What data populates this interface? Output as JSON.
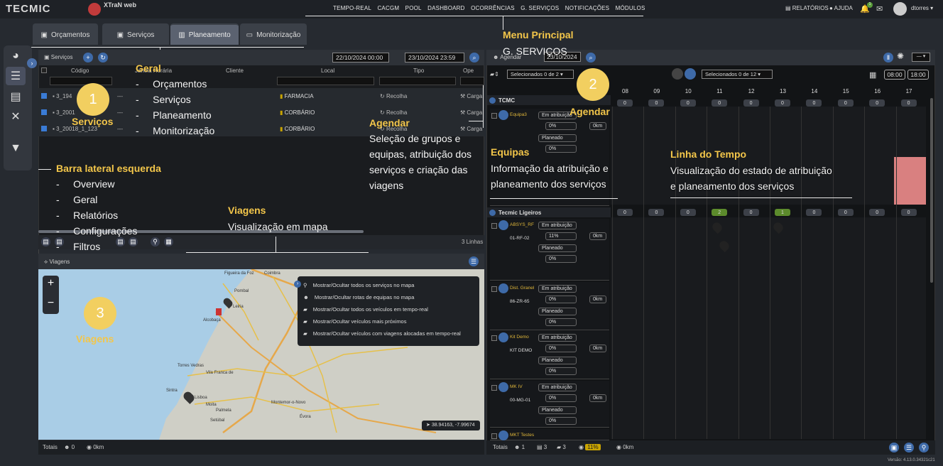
{
  "app": {
    "logo_left": "TECMIC",
    "logo_right": "XTraN web",
    "version": "Versão: 4.13.0.34321c21"
  },
  "topnav": [
    "TEMPO-REAL",
    "CACGM",
    "POOL",
    "DASHBOARD",
    "OCORRÊNCIAS",
    "G. SERVIÇOS",
    "NOTIFICAÇÕES",
    "MÓDULOS"
  ],
  "topright": {
    "reports": "RELATÓRIOS",
    "help": "AJUDA",
    "user": "dtorres",
    "notif_count": "1"
  },
  "tabs": [
    "Orçamentos",
    "Serviços",
    "Planeamento",
    "Monitorização"
  ],
  "services": {
    "title": "Serviços",
    "date_from": "22/10/2024 00:00",
    "date_to": "23/10/2024 23:59",
    "columns": [
      "Código",
      "Janela Horária",
      "Cliente",
      "Local",
      "Tipo",
      "Ope"
    ],
    "rows": [
      {
        "code": "3_194",
        "time": "---",
        "local": "FARMACIA",
        "tipo": "Recolha",
        "op": "Carga"
      },
      {
        "code": "3_2001",
        "time": "---",
        "local": "CORBÁRIO",
        "tipo": "Recolha",
        "op": "Carga"
      },
      {
        "code": "3_20018_1_123",
        "time": "---",
        "local": "CORBÁRIO",
        "tipo": "Recolha",
        "op": "Carga"
      }
    ],
    "lines": "3 Linhas"
  },
  "map": {
    "title": "Viagens",
    "menu": [
      "Mostrar/Ocultar todos os serviços no mapa",
      "Mostrar/Ocultar rotas de equipas no mapa",
      "Mostrar/Ocultar todos os veículos em tempo-real",
      "Mostrar/Ocultar veículos mais próximos",
      "Mostrar/Ocultar veículos com viagens alocadas em tempo-real"
    ],
    "coords": "38.94163, -7.99674",
    "places": [
      "Figueira da Foz",
      "Coimbra",
      "Pombal",
      "Leiria",
      "Alcobaça",
      "Torres Vedras",
      "Vila Franca de",
      "Sintra",
      "Lisboa",
      "Moita",
      "Palmela",
      "Setúbal",
      "Évora",
      "Montemor-o-Novo"
    ],
    "zoom_in": "+",
    "zoom_out": "−"
  },
  "totals_left": {
    "label": "Totais",
    "teams": "0",
    "km": "0km"
  },
  "schedule": {
    "title": "Agendar",
    "date": "23/10/2024",
    "select1": "Selecionados 0 de 2",
    "select2": "Selecionados 0 de 12",
    "time_from": "08:00",
    "time_to": "18:00",
    "hours": [
      "08",
      "09",
      "10",
      "11",
      "12",
      "13",
      "14",
      "15",
      "16",
      "17"
    ],
    "groups": [
      {
        "name": "TCMC",
        "counts": [
          "0",
          "0",
          "0",
          "0",
          "0",
          "0",
          "0",
          "0",
          "0",
          "0"
        ]
      },
      {
        "name": "Tecmic Ligeiros",
        "counts": [
          "0",
          "0",
          "0",
          "2",
          "0",
          "1",
          "0",
          "0",
          "0",
          "0"
        ]
      }
    ],
    "teams": [
      {
        "name": "Equipa3",
        "plate": "",
        "pct1": "0%",
        "pct2": "0%",
        "km": "0km"
      },
      {
        "name": "ABSYS_RF",
        "plate": "01-RF-02",
        "pct1": "11%",
        "pct2": "0%",
        "km": "0km"
      },
      {
        "name": "Dist. Granel",
        "plate": "86-ZR-65",
        "pct1": "0%",
        "pct2": "0%",
        "km": "0km"
      },
      {
        "name": "Kit Demo",
        "plate": "KIT DEMO",
        "pct1": "0%",
        "pct2": "0%",
        "km": "0km"
      },
      {
        "name": "MK IV",
        "plate": "00-MG-01",
        "pct1": "0%",
        "pct2": "0%",
        "km": "0km"
      },
      {
        "name": "MKT Testes",
        "plate": "",
        "pct1": "",
        "pct2": "",
        "km": ""
      }
    ],
    "assign_label": "Em atribuição",
    "planned_label": "Planeado",
    "totals": {
      "label": "Totais",
      "a": "1",
      "b": "3",
      "c": "3",
      "pct": "11%",
      "km": "0km"
    }
  },
  "annotations": {
    "menu": {
      "title": "Menu Principal",
      "text": "G. SERVIÇOS"
    },
    "geral": {
      "title": "Geral",
      "items": [
        "Orçamentos",
        "Serviços",
        "Planeamento",
        "Monitorização"
      ]
    },
    "servicos": {
      "num": "1",
      "title": "Serviços"
    },
    "agendar_num": {
      "num": "2",
      "title": "Agendar"
    },
    "agendar": {
      "title": "Agendar",
      "lines": [
        "Seleção de grupos e",
        "equipas, atribuição dos",
        "serviços e criação das",
        "viagens"
      ]
    },
    "equipas": {
      "title": "Equipas",
      "lines": [
        "Informação da atribuição e",
        "planeamento dos serviços"
      ]
    },
    "timeline": {
      "title": "Linha do Tempo",
      "lines": [
        "Visualização do estado de atribuição",
        "e planeamento dos serviços"
      ]
    },
    "sidebar": {
      "title": "Barra lateral esquerda",
      "items": [
        "Overview",
        "Geral",
        "Relatórios",
        "Configurações",
        "Filtros"
      ]
    },
    "viagens": {
      "title": "Viagens",
      "text": "Visualização em mapa"
    },
    "viagens_num": {
      "num": "3",
      "title": "Viagens"
    }
  }
}
